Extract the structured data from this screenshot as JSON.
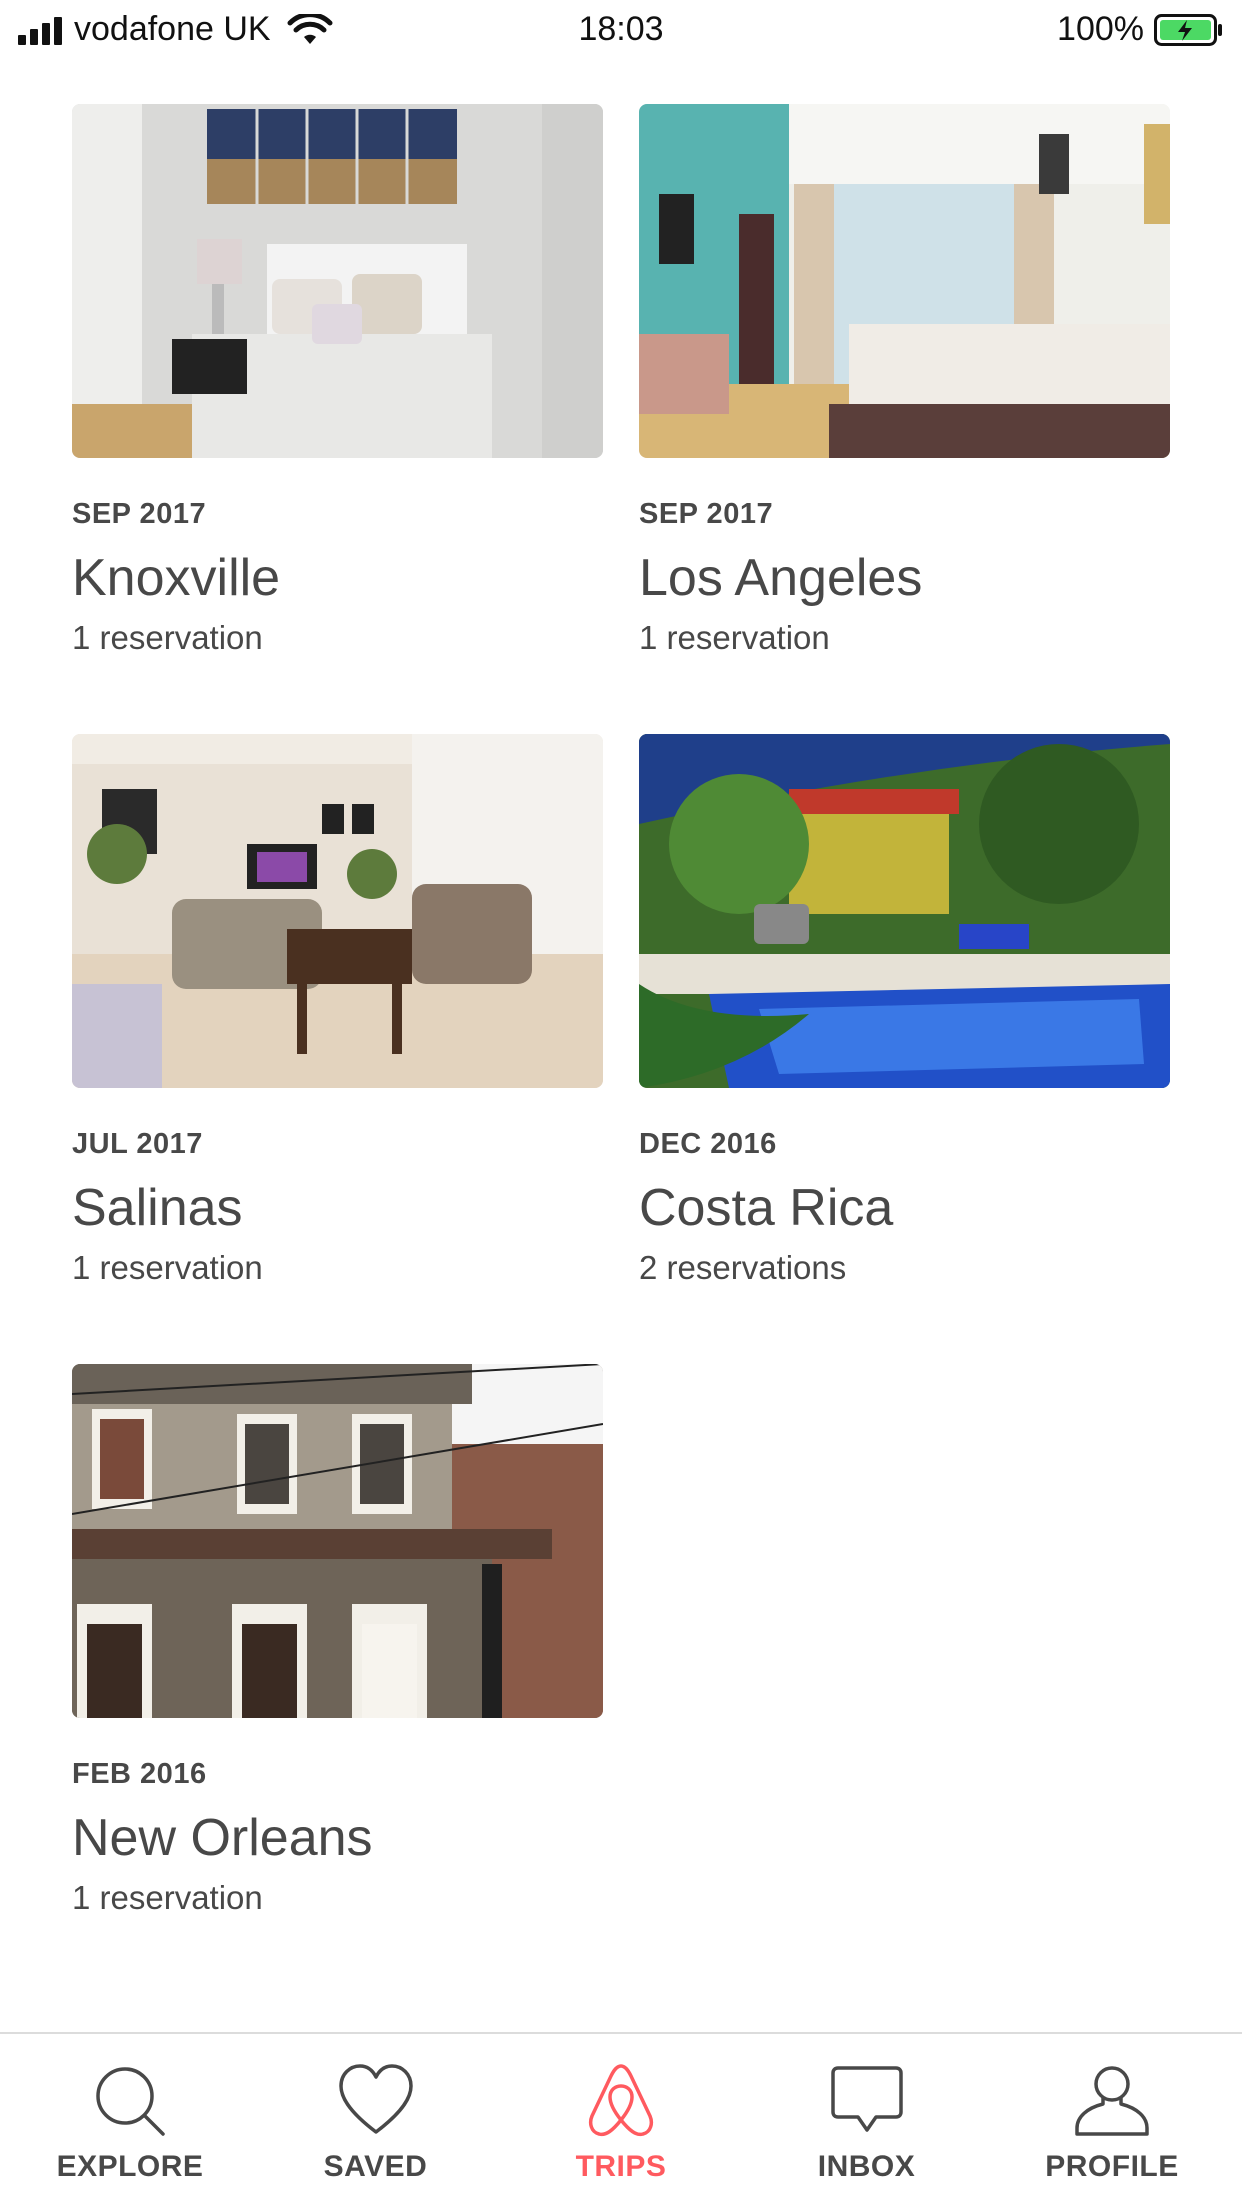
{
  "status_bar": {
    "carrier": "vodafone UK",
    "time": "18:03",
    "battery": "100%"
  },
  "trips": [
    {
      "date": "SEP 2017",
      "city": "Knoxville",
      "reservations": "1 reservation"
    },
    {
      "date": "SEP 2017",
      "city": "Los Angeles",
      "reservations": "1 reservation"
    },
    {
      "date": "JUL 2017",
      "city": "Salinas",
      "reservations": "1 reservation"
    },
    {
      "date": "DEC 2016",
      "city": "Costa Rica",
      "reservations": "2 reservations"
    },
    {
      "date": "FEB 2016",
      "city": "New Orleans",
      "reservations": "1 reservation"
    }
  ],
  "tab_bar": {
    "items": [
      {
        "label": "EXPLORE",
        "icon": "search-icon"
      },
      {
        "label": "SAVED",
        "icon": "heart-icon"
      },
      {
        "label": "TRIPS",
        "icon": "airbnb-logo-icon"
      },
      {
        "label": "INBOX",
        "icon": "chat-bubble-icon"
      },
      {
        "label": "PROFILE",
        "icon": "person-icon"
      }
    ],
    "active": "TRIPS",
    "active_color": "#ff5a5f"
  }
}
